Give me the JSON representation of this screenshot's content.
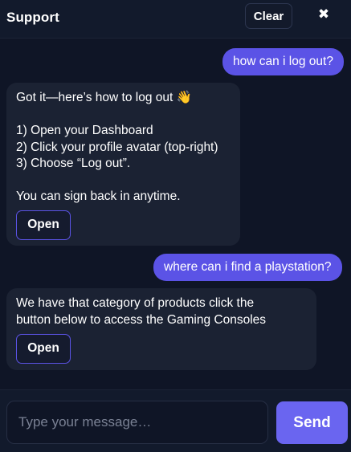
{
  "header": {
    "title": "Support",
    "clear_label": "Clear",
    "close_glyph": "✖"
  },
  "messages": [
    {
      "role": "user",
      "text": "how can i log out?"
    },
    {
      "role": "bot",
      "lines": [
        "Got it—here’s how to log out 👋",
        "",
        "1) Open your Dashboard",
        "2) Click your profile avatar (top-right)",
        "3) Choose “Log out”.",
        "",
        "You can sign back in anytime."
      ],
      "button_label": "Open"
    },
    {
      "role": "user",
      "text": "where can i find a playstation?"
    },
    {
      "role": "bot",
      "lines": [
        "We have that category of products click the",
        "button below to access the Gaming Consoles"
      ],
      "button_label": "Open"
    }
  ],
  "composer": {
    "placeholder": "Type your message…",
    "value": "",
    "send_label": "Send"
  },
  "colors": {
    "background": "#0f1526",
    "header": "#121a2c",
    "bot_bubble": "#1b2233",
    "user_bubble": "#5b53e6",
    "send_button": "#6a65f0"
  },
  "icons": {
    "close": "close-icon",
    "wave": "waving-hand-emoji"
  }
}
